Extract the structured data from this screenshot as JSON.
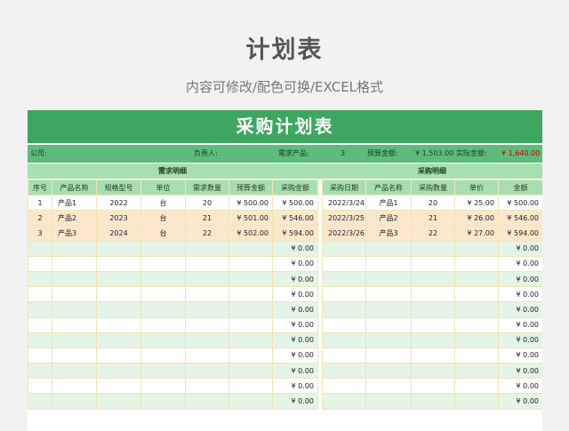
{
  "title": "计划表",
  "subtitle": "内容可修改/配色可换/EXCEL格式",
  "sheet": {
    "title": "采购计划表",
    "info": {
      "company_label": "公司:",
      "owner_label": "负责人:",
      "demand_label": "需求产品:",
      "demand_value": "3",
      "budget_label": "预算金额:",
      "budget_value": "¥ 1,503.00",
      "actual_label": "实际金额:",
      "actual_value": "¥ 1,640.00"
    },
    "sections": {
      "left": "需求明细",
      "right": "采购明细"
    },
    "headers": [
      "序号",
      "产品名称",
      "规格型号",
      "单位",
      "需求数量",
      "预算金额",
      "采购金额",
      "采购日期",
      "产品名称",
      "采购数量",
      "单价",
      "金额"
    ],
    "rows": [
      [
        "1",
        "产品1",
        "2022",
        "台",
        "20",
        "¥ 500.00",
        "¥ 500.00",
        "2022/3/24",
        "产品1",
        "20",
        "¥ 25.00",
        "¥ 500.00"
      ],
      [
        "2",
        "产品2",
        "2023",
        "台",
        "21",
        "¥ 501.00",
        "¥ 546.00",
        "2022/3/25",
        "产品2",
        "21",
        "¥ 26.00",
        "¥ 546.00"
      ],
      [
        "3",
        "产品3",
        "2024",
        "台",
        "22",
        "¥ 502.00",
        "¥ 594.00",
        "2022/3/26",
        "产品3",
        "22",
        "¥ 27.00",
        "¥ 594.00"
      ],
      [
        "",
        "",
        "",
        "",
        "",
        "",
        "¥ 0.00",
        "",
        "",
        "",
        "",
        "¥ 0.00"
      ],
      [
        "",
        "",
        "",
        "",
        "",
        "",
        "¥ 0.00",
        "",
        "",
        "",
        "",
        "¥ 0.00"
      ],
      [
        "",
        "",
        "",
        "",
        "",
        "",
        "¥ 0.00",
        "",
        "",
        "",
        "",
        "¥ 0.00"
      ],
      [
        "",
        "",
        "",
        "",
        "",
        "",
        "¥ 0.00",
        "",
        "",
        "",
        "",
        "¥ 0.00"
      ],
      [
        "",
        "",
        "",
        "",
        "",
        "",
        "¥ 0.00",
        "",
        "",
        "",
        "",
        "¥ 0.00"
      ],
      [
        "",
        "",
        "",
        "",
        "",
        "",
        "¥ 0.00",
        "",
        "",
        "",
        "",
        "¥ 0.00"
      ],
      [
        "",
        "",
        "",
        "",
        "",
        "",
        "¥ 0.00",
        "",
        "",
        "",
        "",
        "¥ 0.00"
      ],
      [
        "",
        "",
        "",
        "",
        "",
        "",
        "¥ 0.00",
        "",
        "",
        "",
        "",
        "¥ 0.00"
      ],
      [
        "",
        "",
        "",
        "",
        "",
        "",
        "¥ 0.00",
        "",
        "",
        "",
        "",
        "¥ 0.00"
      ],
      [
        "",
        "",
        "",
        "",
        "",
        "",
        "¥ 0.00",
        "",
        "",
        "",
        "",
        "¥ 0.00"
      ],
      [
        "",
        "",
        "",
        "",
        "",
        "",
        "¥ 0.00",
        "",
        "",
        "",
        "",
        "¥ 0.00"
      ]
    ],
    "colors": {
      "title_bg": "#3da660",
      "info_bg": "#5dbc7b",
      "header_bg": "#a7dfb1",
      "filled_row_bg": "#fbe8cc",
      "alt_row_bg": "#e4f4e6",
      "actual_value": "#c00000"
    }
  }
}
